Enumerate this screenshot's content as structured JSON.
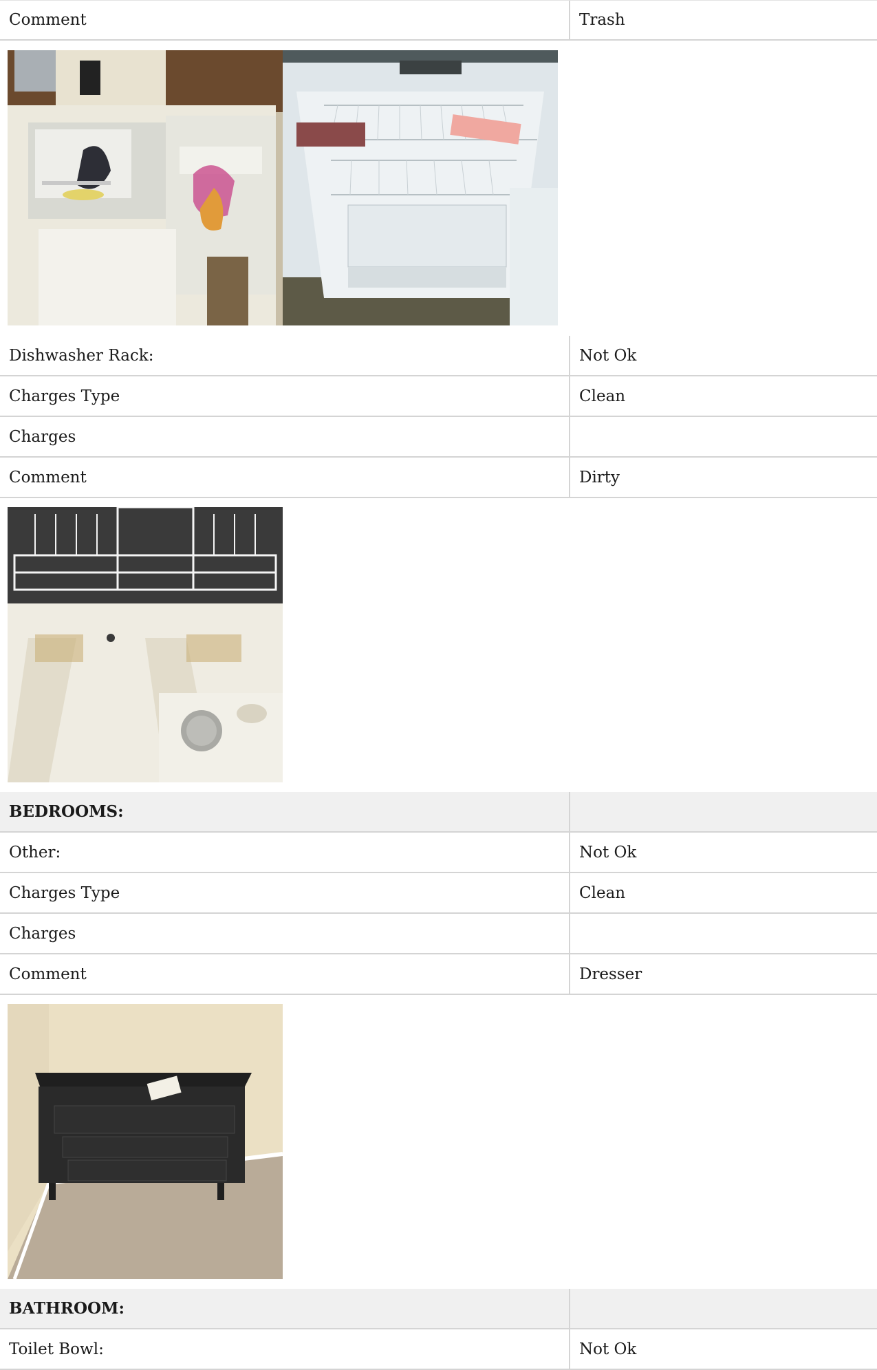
{
  "rows": [
    {
      "label": "Comment",
      "value": "Trash"
    },
    {
      "label": "Dishwasher Rack:",
      "value": "Not Ok"
    },
    {
      "label": "Charges Type",
      "value": "Clean"
    },
    {
      "label": "Charges",
      "value": ""
    },
    {
      "label": "Comment",
      "value": "Dirty"
    },
    {
      "label": "BEDROOMS:",
      "value": ""
    },
    {
      "label": "Other:",
      "value": "Not Ok"
    },
    {
      "label": "Charges Type",
      "value": "Clean"
    },
    {
      "label": "Charges",
      "value": ""
    },
    {
      "label": "Comment",
      "value": "Dresser"
    },
    {
      "label": "BATHROOM:",
      "value": ""
    },
    {
      "label": "Toilet Bowl:",
      "value": "Not Ok"
    }
  ],
  "colors": {
    "border": "#d4d4d4",
    "section_header_bg": "#f0f0f0"
  }
}
